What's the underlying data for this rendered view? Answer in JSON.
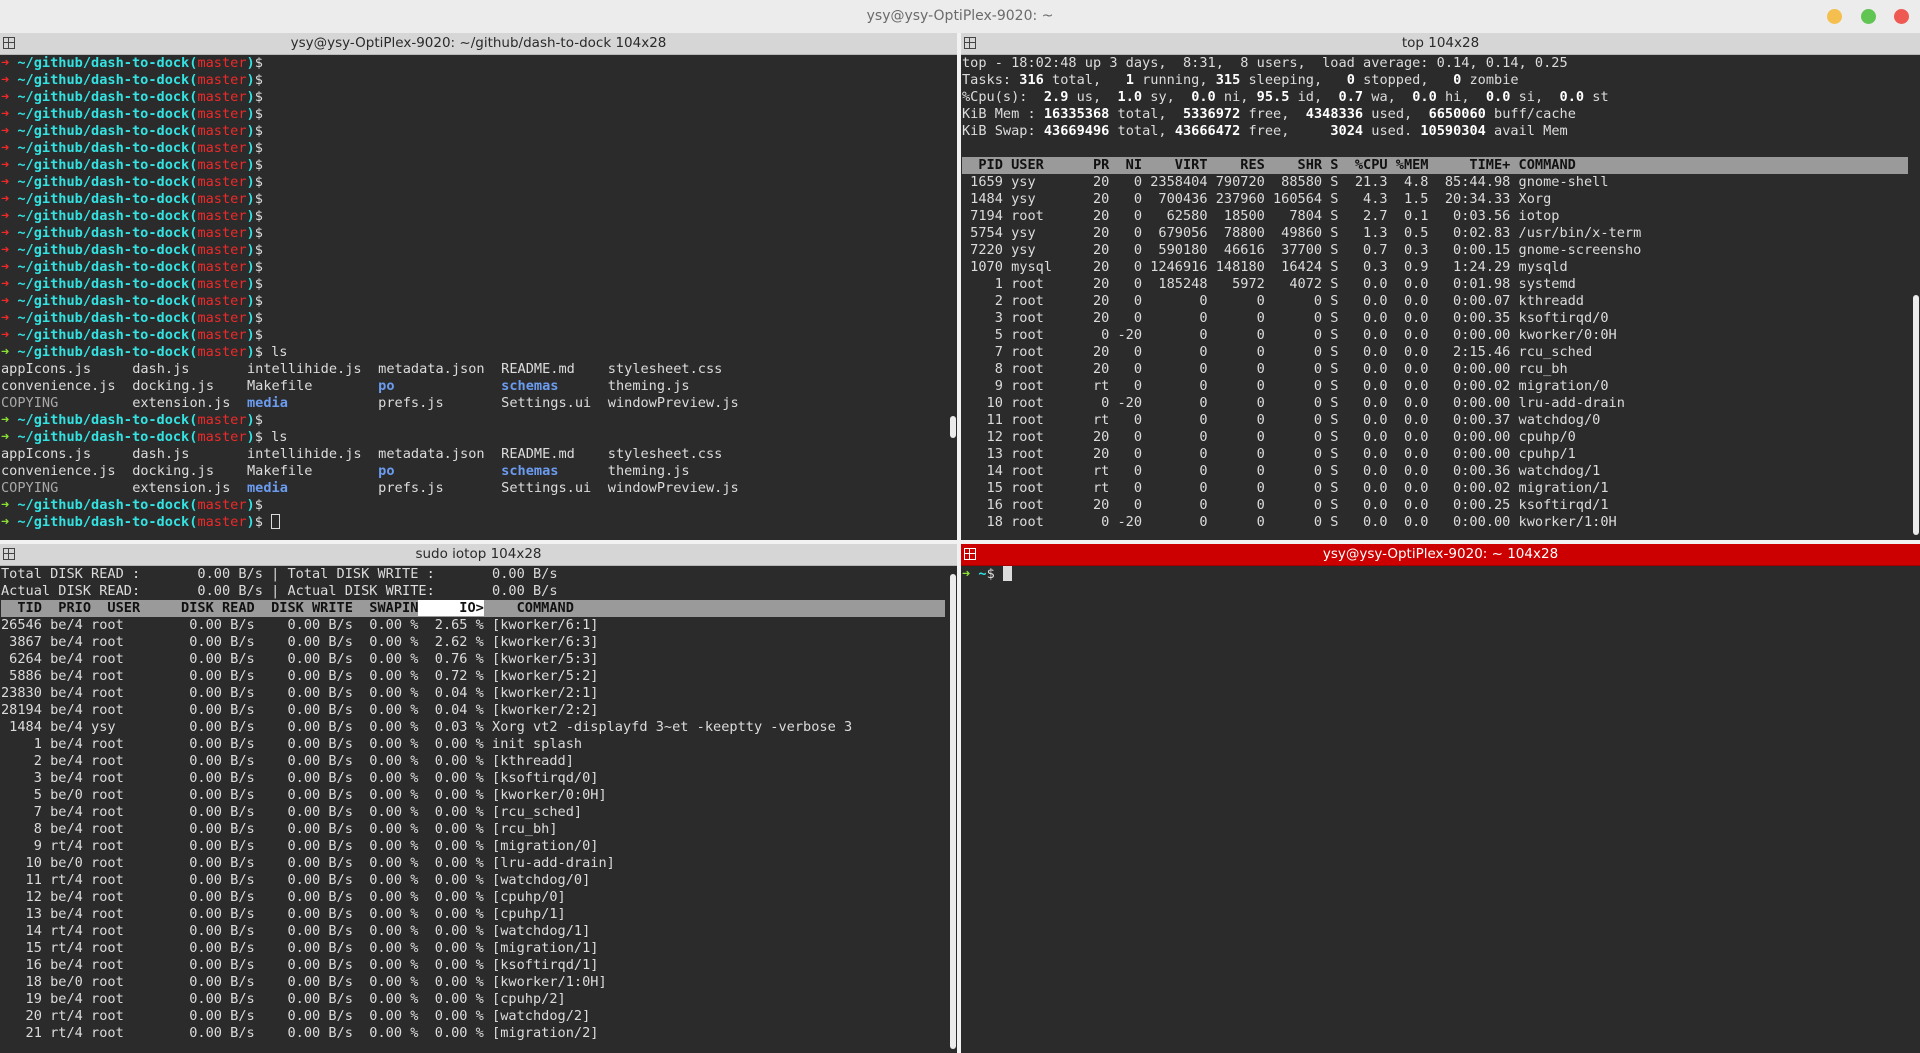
{
  "window": {
    "title": "ysy@ysy-OptiPlex-9020: ~"
  },
  "panes": {
    "top_left": {
      "title": "ysy@ysy-OptiPlex-9020: ~/github/dash-to-dock 104x28",
      "prompt": {
        "path": "~/github/dash-to-dock",
        "branch": "master"
      },
      "repeat_prompts": 17,
      "ls_command": "ls",
      "ls_rows": [
        [
          "appIcons.js",
          "dash.js",
          "intellihide.js",
          "metadata.json",
          "README.md",
          "stylesheet.css"
        ],
        [
          "convenience.js",
          "docking.js",
          "Makefile",
          "po",
          "schemas",
          "theming.js"
        ],
        [
          "COPYING",
          "extension.js",
          "media",
          "prefs.js",
          "Settings.ui",
          "windowPreview.js"
        ]
      ],
      "dir_entries": [
        "po",
        "schemas",
        "media"
      ],
      "gray_entries": [
        "COPYING"
      ]
    },
    "top_right": {
      "title": "top 104x28",
      "summary": {
        "line1": "top - 18:02:48 up 3 days,  8:31,  8 users,  load average: 0.14, 0.14, 0.25",
        "tasks": {
          "total": "316",
          "running": "1",
          "sleeping": "315",
          "stopped": "0",
          "zombie": "0"
        },
        "cpu": {
          "us": "2.9",
          "sy": "1.0",
          "ni": "0.0",
          "id": "95.5",
          "wa": "0.7",
          "hi": "0.0",
          "si": "0.0",
          "st": "0.0"
        },
        "mem": {
          "total": "16335368",
          "free": "5336972",
          "used": "4348336",
          "buff": "6650060"
        },
        "swap": {
          "total": "43669496",
          "free": "43666472",
          "used": "3024",
          "avail": "10590304"
        }
      },
      "header": "  PID USER      PR  NI    VIRT    RES    SHR S  %CPU %MEM     TIME+ COMMAND",
      "rows": [
        " 1659 ysy       20   0 2358404 790720  88580 S  21.3  4.8  85:44.98 gnome-shell",
        " 1484 ysy       20   0  700436 237960 160564 S   4.3  1.5  20:34.33 Xorg",
        " 7194 root      20   0   62580  18500   7804 S   2.7  0.1   0:03.56 iotop",
        " 5754 ysy       20   0  679056  78800  49860 S   1.3  0.5   0:02.83 /usr/bin/x-term",
        " 7220 ysy       20   0  590180  46616  37700 S   0.7  0.3   0:00.15 gnome-screensho",
        " 1070 mysql     20   0 1246916 148180  16424 S   0.3  0.9   1:24.29 mysqld",
        "    1 root      20   0  185248   5972   4072 S   0.0  0.0   0:01.98 systemd",
        "    2 root      20   0       0      0      0 S   0.0  0.0   0:00.07 kthreadd",
        "    3 root      20   0       0      0      0 S   0.0  0.0   0:00.35 ksoftirqd/0",
        "    5 root       0 -20       0      0      0 S   0.0  0.0   0:00.00 kworker/0:0H",
        "    7 root      20   0       0      0      0 S   0.0  0.0   2:15.46 rcu_sched",
        "    8 root      20   0       0      0      0 S   0.0  0.0   0:00.00 rcu_bh",
        "    9 root      rt   0       0      0      0 S   0.0  0.0   0:00.02 migration/0",
        "   10 root       0 -20       0      0      0 S   0.0  0.0   0:00.00 lru-add-drain",
        "   11 root      rt   0       0      0      0 S   0.0  0.0   0:00.37 watchdog/0",
        "   12 root      20   0       0      0      0 S   0.0  0.0   0:00.00 cpuhp/0",
        "   13 root      20   0       0      0      0 S   0.0  0.0   0:00.00 cpuhp/1",
        "   14 root      rt   0       0      0      0 S   0.0  0.0   0:00.36 watchdog/1",
        "   15 root      rt   0       0      0      0 S   0.0  0.0   0:00.02 migration/1",
        "   16 root      20   0       0      0      0 S   0.0  0.0   0:00.25 ksoftirqd/1",
        "   18 root       0 -20       0      0      0 S   0.0  0.0   0:00.00 kworker/1:0H"
      ]
    },
    "bottom_left": {
      "title": "sudo iotop 104x28",
      "totals": [
        "Total DISK READ :       0.00 B/s | Total DISK WRITE :       0.00 B/s",
        "Actual DISK READ:       0.00 B/s | Actual DISK WRITE:       0.00 B/s"
      ],
      "header_left": "  TID  PRIO  USER     DISK READ  DISK WRITE  SWAPIN",
      "header_io": "     IO>",
      "header_right": "    COMMAND",
      "rows": [
        "26546 be/4 root        0.00 B/s    0.00 B/s  0.00 %  2.65 % [kworker/6:1]",
        " 3867 be/4 root        0.00 B/s    0.00 B/s  0.00 %  2.62 % [kworker/6:3]",
        " 6264 be/4 root        0.00 B/s    0.00 B/s  0.00 %  0.76 % [kworker/5:3]",
        " 5886 be/4 root        0.00 B/s    0.00 B/s  0.00 %  0.72 % [kworker/5:2]",
        "23830 be/4 root        0.00 B/s    0.00 B/s  0.00 %  0.04 % [kworker/2:1]",
        "28194 be/4 root        0.00 B/s    0.00 B/s  0.00 %  0.04 % [kworker/2:2]",
        " 1484 be/4 ysy         0.00 B/s    0.00 B/s  0.00 %  0.03 % Xorg vt2 -displayfd 3~et -keeptty -verbose 3",
        "    1 be/4 root        0.00 B/s    0.00 B/s  0.00 %  0.00 % init splash",
        "    2 be/4 root        0.00 B/s    0.00 B/s  0.00 %  0.00 % [kthreadd]",
        "    3 be/4 root        0.00 B/s    0.00 B/s  0.00 %  0.00 % [ksoftirqd/0]",
        "    5 be/0 root        0.00 B/s    0.00 B/s  0.00 %  0.00 % [kworker/0:0H]",
        "    7 be/4 root        0.00 B/s    0.00 B/s  0.00 %  0.00 % [rcu_sched]",
        "    8 be/4 root        0.00 B/s    0.00 B/s  0.00 %  0.00 % [rcu_bh]",
        "    9 rt/4 root        0.00 B/s    0.00 B/s  0.00 %  0.00 % [migration/0]",
        "   10 be/0 root        0.00 B/s    0.00 B/s  0.00 %  0.00 % [lru-add-drain]",
        "   11 rt/4 root        0.00 B/s    0.00 B/s  0.00 %  0.00 % [watchdog/0]",
        "   12 be/4 root        0.00 B/s    0.00 B/s  0.00 %  0.00 % [cpuhp/0]",
        "   13 be/4 root        0.00 B/s    0.00 B/s  0.00 %  0.00 % [cpuhp/1]",
        "   14 rt/4 root        0.00 B/s    0.00 B/s  0.00 %  0.00 % [watchdog/1]",
        "   15 rt/4 root        0.00 B/s    0.00 B/s  0.00 %  0.00 % [migration/1]",
        "   16 be/4 root        0.00 B/s    0.00 B/s  0.00 %  0.00 % [ksoftirqd/1]",
        "   18 be/0 root        0.00 B/s    0.00 B/s  0.00 %  0.00 % [kworker/1:0H]",
        "   19 be/4 root        0.00 B/s    0.00 B/s  0.00 %  0.00 % [cpuhp/2]",
        "   20 rt/4 root        0.00 B/s    0.00 B/s  0.00 %  0.00 % [watchdog/2]",
        "   21 rt/4 root        0.00 B/s    0.00 B/s  0.00 %  0.00 % [migration/2]"
      ]
    },
    "bottom_right": {
      "title": "ysy@ysy-OptiPlex-9020: ~ 104x28",
      "prompt_path": "~",
      "prompt_symbol": "$"
    }
  },
  "colors": {
    "pane_active_header": "#cc0000",
    "prompt_arrow_red": "#ef2929",
    "prompt_arrow_green": "#8ae234",
    "path_cyan": "#34e2e2",
    "dir_blue": "#6b9cf0"
  }
}
